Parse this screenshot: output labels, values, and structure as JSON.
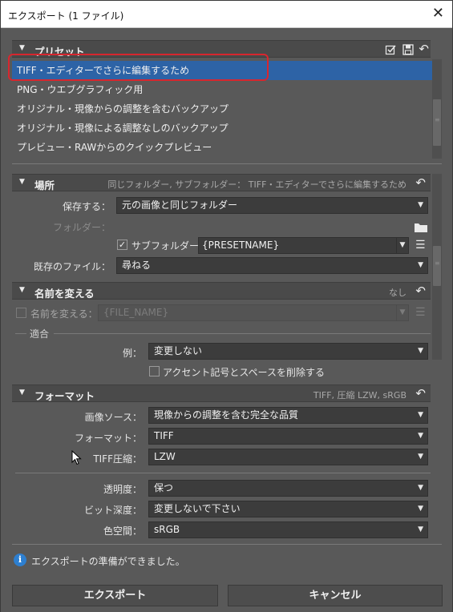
{
  "window": {
    "title": "エクスポート (1 ファイル)",
    "close_glyph": "✕"
  },
  "preset": {
    "header": "プリセット",
    "items": [
      "TIFF・エディターでさらに編集するため",
      "PNG・ウエブグラフィック用",
      "オリジナル・現像からの調整を含むバックアップ",
      "オリジナル・現像による調整なしのバックアップ",
      "プレビュー・RAWからのクイックプレビュー"
    ],
    "selected_index": 0
  },
  "location": {
    "header": "場所",
    "summary": "同じフォルダー, サブフォルダー： TIFF・エディターでさらに編集するため",
    "save_to_label": "保存する：",
    "save_to_value": "元の画像と同じフォルダー",
    "folder_label": "フォルダー：",
    "subfolder_label": "サブフォルダー：",
    "subfolder_checked": true,
    "subfolder_value": "{PRESETNAME}",
    "existing_label": "既存のファイル：",
    "existing_value": "尋ねる"
  },
  "rename": {
    "header": "名前を変える",
    "summary": "なし",
    "rename_label": "名前を変える：",
    "rename_value": "{FILE_NAME}",
    "rename_checked": false,
    "apply_label": "適合",
    "example_label": "例：",
    "example_value": "変更しない",
    "remove_accents_label": "アクセント記号とスペースを削除する",
    "remove_accents_checked": false
  },
  "format": {
    "header": "フォーマット",
    "summary": "TIFF, 圧縮 LZW, sRGB",
    "image_source_label": "画像ソース：",
    "image_source_value": "現像からの調整を含む完全な品質",
    "format_label": "フォーマット：",
    "format_value": "TIFF",
    "compression_label": "TIFF圧縮：",
    "compression_value": "LZW",
    "transparency_label": "透明度：",
    "transparency_value": "保つ",
    "bit_depth_label": "ビット深度：",
    "bit_depth_value": "変更しないで下さい",
    "color_space_label": "色空間：",
    "color_space_value": "sRGB"
  },
  "status": {
    "text": "エクスポートの準備ができました。"
  },
  "buttons": {
    "export": "エクスポート",
    "cancel": "キャンセル"
  },
  "glyphs": {
    "reset": "↶",
    "triangle": "▼",
    "dropdown": "▼",
    "check": "✓",
    "menu": "☰",
    "info": "i"
  },
  "colors": {
    "selection": "#2d63a6",
    "highlight_outline": "#d8262e",
    "panel": "#595959",
    "info": "#2d7fd0"
  }
}
